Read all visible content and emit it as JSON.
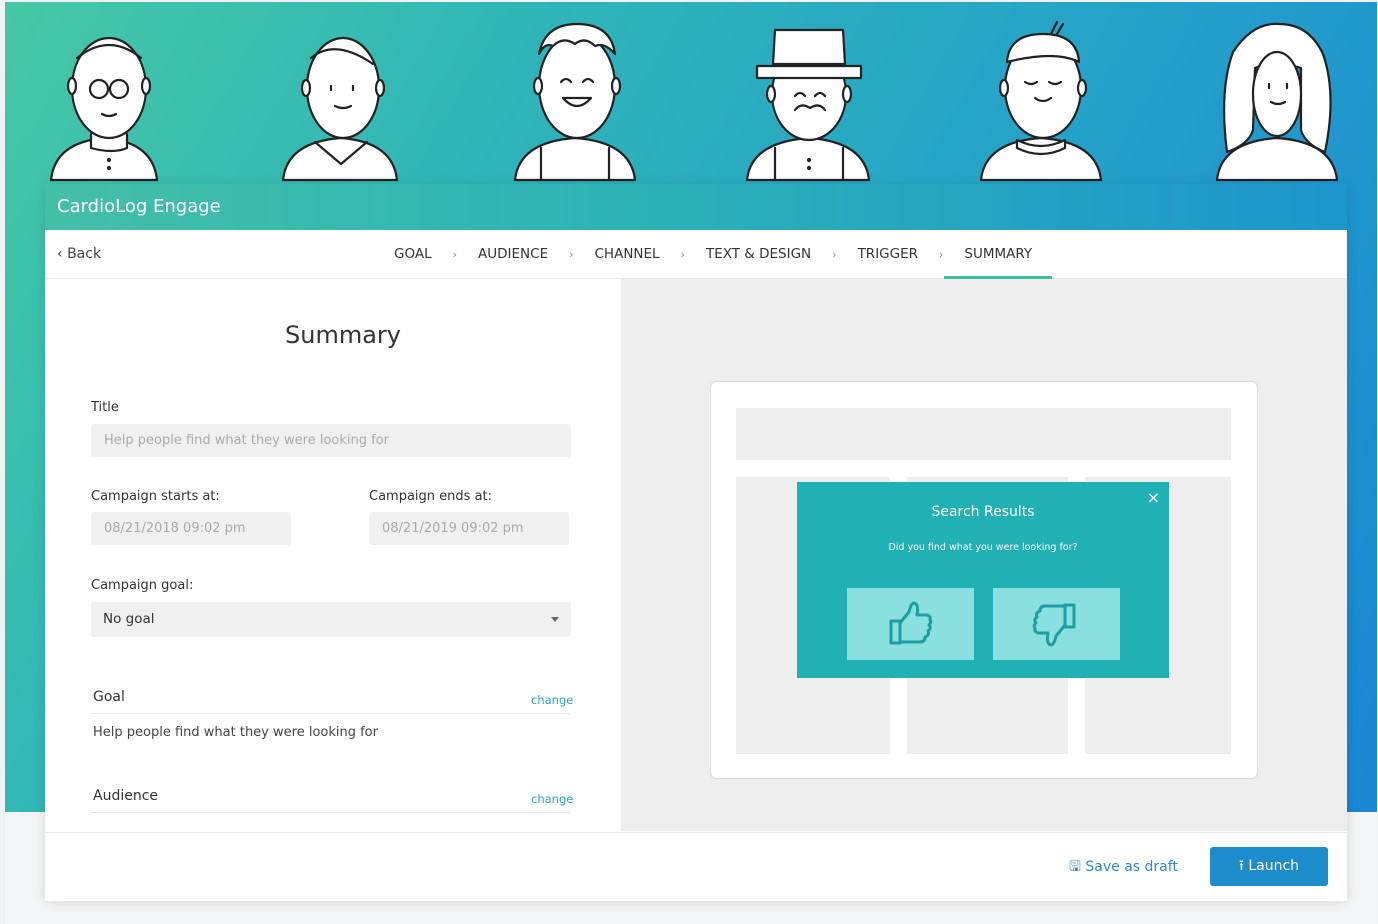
{
  "app": {
    "title": "CardioLog Engage"
  },
  "nav": {
    "back_label": "Back",
    "steps": [
      "GOAL",
      "AUDIENCE",
      "CHANNEL",
      "TEXT & DESIGN",
      "TRIGGER",
      "SUMMARY"
    ],
    "active_step": "SUMMARY"
  },
  "summary": {
    "heading": "Summary",
    "title_label": "Title",
    "title_placeholder": "Help people find what they were looking for",
    "start_label": "Campaign starts at:",
    "start_value": "08/21/2018 09:02 pm",
    "end_label": "Campaign ends at:",
    "end_value": "08/21/2019 09:02 pm",
    "goal_select_label": "Campaign goal:",
    "goal_select_value": "No goal",
    "sections": [
      {
        "title": "Goal",
        "change": "change",
        "text": "Help people find what they were looking for"
      },
      {
        "title": "Audience",
        "change": "change",
        "text": ""
      }
    ]
  },
  "preview": {
    "popup_title": "Search Results",
    "popup_question": "Did you find what you were looking for?",
    "close_symbol": "×"
  },
  "footer": {
    "save_draft": "Save as draft",
    "launch": "Launch"
  },
  "colors": {
    "accent": "#3cbf9f",
    "popup": "#21b0b4",
    "vote_button": "#89e0de",
    "primary": "#1d8ccc"
  },
  "icons": [
    "face-glasses-icon",
    "face-smile-icon",
    "face-laugh-icon",
    "face-hat-icon",
    "face-content-icon",
    "face-longhair-icon",
    "thumbs-up-icon",
    "thumbs-down-icon",
    "floppy-disk-icon",
    "upload-icon"
  ]
}
